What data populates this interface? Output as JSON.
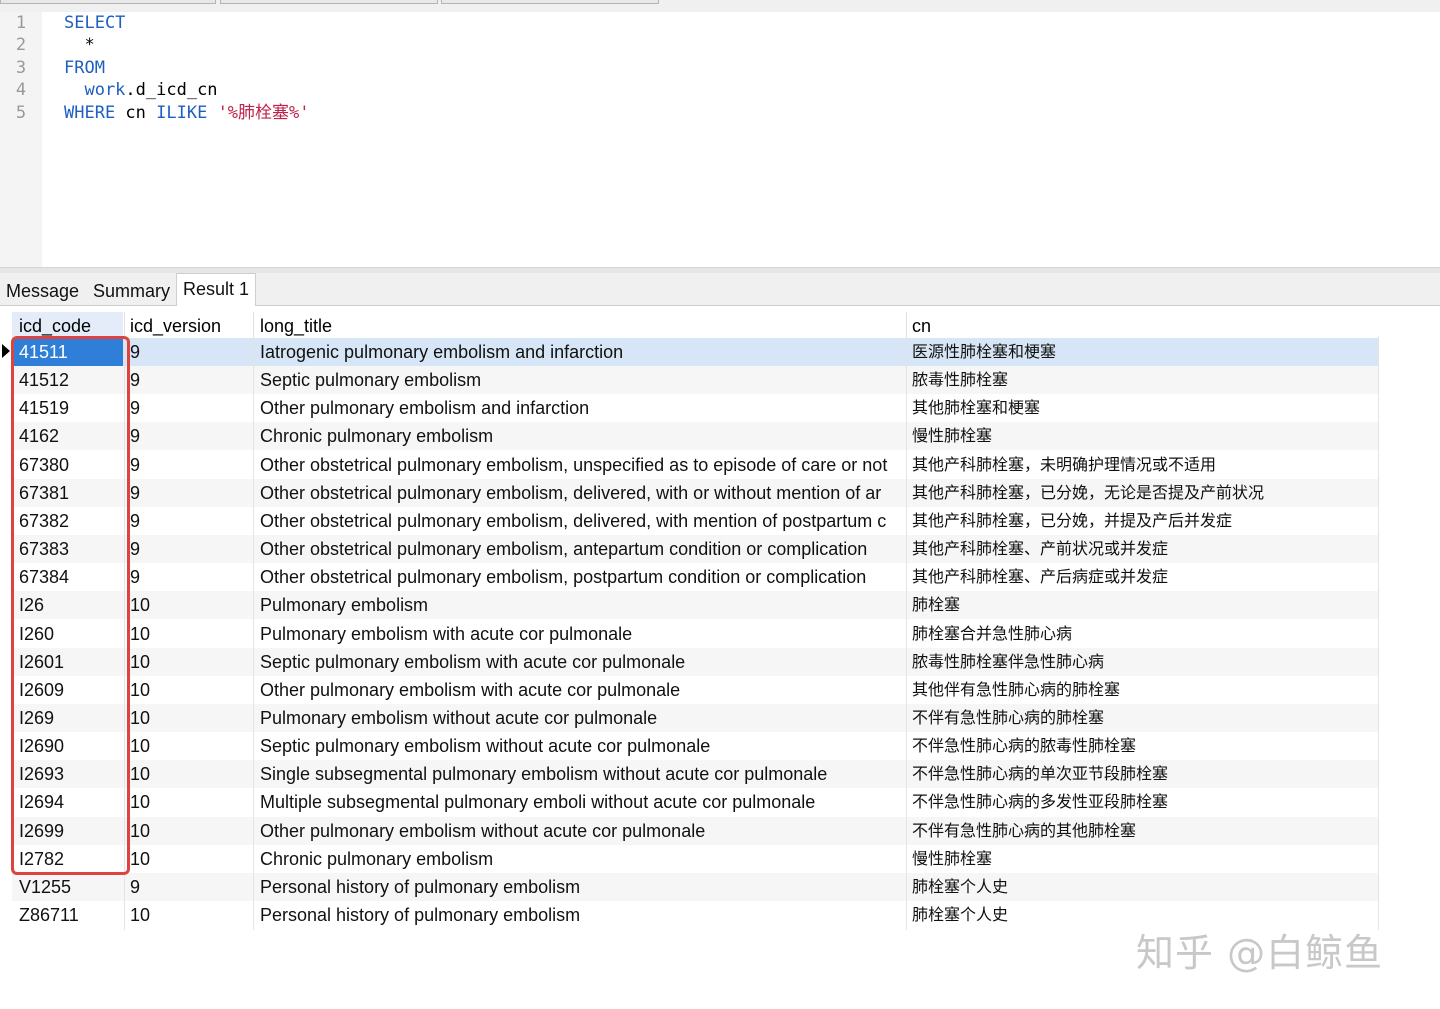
{
  "editor": {
    "line_numbers": [
      "1",
      "2",
      "3",
      "4",
      "5"
    ],
    "lines": [
      {
        "kw": "SELECT",
        "rest": "",
        "str": ""
      },
      {
        "kw": "",
        "rest": "  *",
        "str": ""
      },
      {
        "kw": "FROM",
        "rest": "",
        "str": ""
      },
      {
        "kw": "  work",
        "rest": ".d_icd_cn",
        "str": ""
      },
      {
        "kw": "WHERE",
        "rest": " cn ",
        "kw2": "ILIKE",
        "str": " '%肺栓塞%'"
      }
    ]
  },
  "result_tabs": [
    "Message",
    "Summary",
    "Result 1"
  ],
  "active_tab": "Result 1",
  "grid": {
    "columns": [
      "icd_code",
      "icd_version",
      "long_title",
      "cn"
    ],
    "selected_row": 0,
    "rows": [
      [
        "41511",
        "9",
        "Iatrogenic pulmonary embolism and infarction",
        "医源性肺栓塞和梗塞"
      ],
      [
        "41512",
        "9",
        "Septic pulmonary embolism",
        "脓毒性肺栓塞"
      ],
      [
        "41519",
        "9",
        "Other pulmonary embolism and infarction",
        "其他肺栓塞和梗塞"
      ],
      [
        "4162",
        "9",
        "Chronic pulmonary embolism",
        "慢性肺栓塞"
      ],
      [
        "67380",
        "9",
        "Other obstetrical pulmonary embolism, unspecified as to episode of care or not",
        "其他产科肺栓塞，未明确护理情况或不适用"
      ],
      [
        "67381",
        "9",
        "Other obstetrical pulmonary embolism, delivered, with or without mention of ar",
        "其他产科肺栓塞，已分娩，无论是否提及产前状况"
      ],
      [
        "67382",
        "9",
        "Other obstetrical pulmonary embolism, delivered, with mention of postpartum c",
        "其他产科肺栓塞，已分娩，并提及产后并发症"
      ],
      [
        "67383",
        "9",
        "Other obstetrical pulmonary embolism, antepartum condition or complication",
        "其他产科肺栓塞、产前状况或并发症"
      ],
      [
        "67384",
        "9",
        "Other obstetrical pulmonary embolism, postpartum condition or complication",
        "其他产科肺栓塞、产后病症或并发症"
      ],
      [
        "I26",
        "10",
        "Pulmonary embolism",
        "肺栓塞"
      ],
      [
        "I260",
        "10",
        "Pulmonary embolism with acute cor pulmonale",
        "肺栓塞合并急性肺心病"
      ],
      [
        "I2601",
        "10",
        "Septic pulmonary embolism with acute cor pulmonale",
        "脓毒性肺栓塞伴急性肺心病"
      ],
      [
        "I2609",
        "10",
        "Other pulmonary embolism with acute cor pulmonale",
        "其他伴有急性肺心病的肺栓塞"
      ],
      [
        "I269",
        "10",
        "Pulmonary embolism without acute cor pulmonale",
        "不伴有急性肺心病的肺栓塞"
      ],
      [
        "I2690",
        "10",
        "Septic pulmonary embolism without acute cor pulmonale",
        "不伴急性肺心病的脓毒性肺栓塞"
      ],
      [
        "I2693",
        "10",
        "Single subsegmental pulmonary embolism without acute cor pulmonale",
        "不伴急性肺心病的单次亚节段肺栓塞"
      ],
      [
        "I2694",
        "10",
        "Multiple subsegmental pulmonary emboli without acute cor pulmonale",
        "不伴急性肺心病的多发性亚段肺栓塞"
      ],
      [
        "I2699",
        "10",
        "Other pulmonary embolism without acute cor pulmonale",
        "不伴有急性肺心病的其他肺栓塞"
      ],
      [
        "I2782",
        "10",
        "Chronic pulmonary embolism",
        "慢性肺栓塞"
      ],
      [
        "V1255",
        "9",
        "Personal history of pulmonary embolism",
        "肺栓塞个人史"
      ],
      [
        "Z86711",
        "10",
        "Personal history of pulmonary embolism",
        "肺栓塞个人史"
      ]
    ]
  },
  "watermark": "知乎 @白鲸鱼",
  "colors": {
    "selection": "#2f7fd9",
    "highlight_box": "#e0423f",
    "keyword": "#1f5fbf",
    "string": "#c0224a"
  }
}
